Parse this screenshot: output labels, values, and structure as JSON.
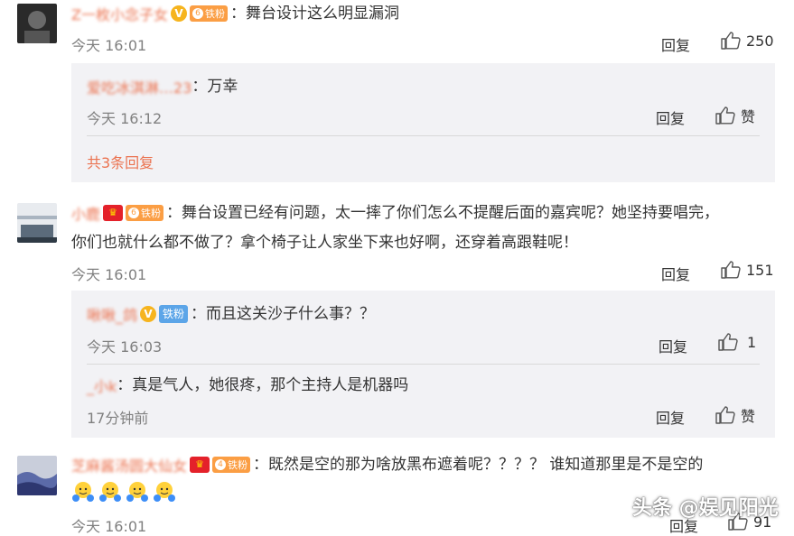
{
  "labels": {
    "reply": "回复",
    "like": "赞"
  },
  "comments": [
    {
      "username": "Z一枚小念子女",
      "text": "：舞台设计这么明显漏洞",
      "time": "今天 16:01",
      "like_count": "250",
      "fan_badge": "铁粉",
      "fan_level": "6",
      "replies": [
        {
          "username": "爱吃冰淇淋…23",
          "text": "：万幸",
          "time": "今天 16:12"
        }
      ],
      "more_replies": "共3条回复"
    },
    {
      "username": "小鹿",
      "text_line1": "：舞台设置已经有问题，太一摔了你们怎么不提醒后面的嘉宾呢？她坚持要唱完，",
      "text_line2": "你们也就什么都不做了？拿个椅子让人家坐下来也好啊，还穿着高跟鞋呢！",
      "time": "今天 16:01",
      "like_count": "151",
      "fan_badge": "铁粉",
      "fan_level": "6",
      "replies": [
        {
          "username": "啾啾_鸽",
          "badge": "铁粉",
          "text": "：而且这关沙子什么事？？",
          "time": "今天 16:03",
          "like_count": "1"
        },
        {
          "username": "_小k",
          "text": "：真是气人，她很疼，那个主持人是机器吗",
          "time": "17分钟前"
        }
      ]
    },
    {
      "username": "芝麻酱汤圆大仙女",
      "text": "：既然是空的那为啥放黑布遮着呢？？？？ 谁知道那里是不是空的",
      "time": "今天 16:01",
      "like_count": "91",
      "fan_badge": "铁粉",
      "fan_level": "4"
    }
  ],
  "watermark": "头条 @娱见阳光",
  "colors": {
    "accent": "#eb7350",
    "reply_bg": "#f2f2f5",
    "muted": "#808080"
  }
}
